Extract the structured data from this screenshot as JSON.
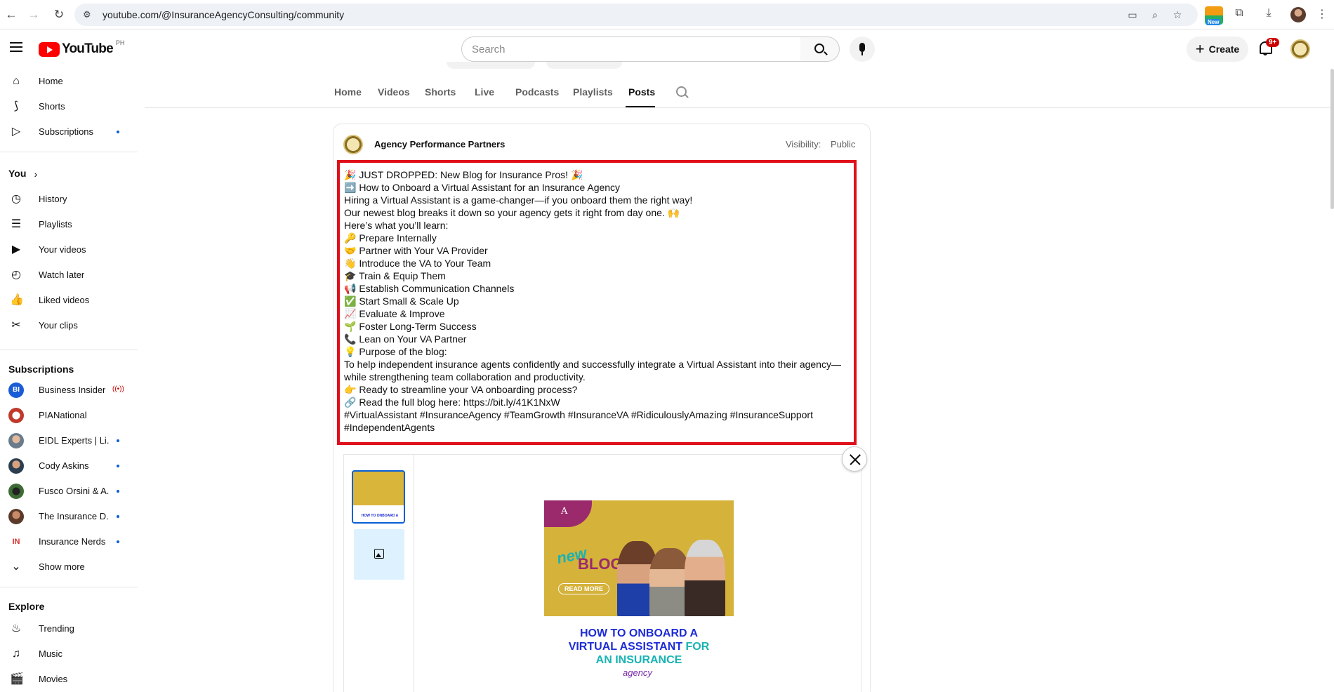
{
  "browser": {
    "url": "youtube.com/@InsuranceAgencyConsulting/community",
    "ext_badge": "New"
  },
  "header": {
    "logo_text": "YouTube",
    "country_code": "PH",
    "search_placeholder": "Search",
    "create_label": "Create",
    "notification_count": "9+"
  },
  "sidebar": {
    "main_items": [
      {
        "label": "Home",
        "icon": "home-icon"
      },
      {
        "label": "Shorts",
        "icon": "shorts-icon"
      },
      {
        "label": "Subscriptions",
        "icon": "subscriptions-icon"
      }
    ],
    "you_title": "You",
    "you_items": [
      {
        "label": "History",
        "icon": "history-icon"
      },
      {
        "label": "Playlists",
        "icon": "playlists-icon"
      },
      {
        "label": "Your videos",
        "icon": "your-videos-icon"
      },
      {
        "label": "Watch later",
        "icon": "watch-later-icon"
      },
      {
        "label": "Liked videos",
        "icon": "liked-videos-icon"
      },
      {
        "label": "Your clips",
        "icon": "clips-icon"
      }
    ],
    "subscriptions_title": "Subscriptions",
    "subscriptions": [
      {
        "label": "Business Insider",
        "color": "#1a5bd6",
        "status": "live"
      },
      {
        "label": "PIANational",
        "color": "#c0392b",
        "status": "none"
      },
      {
        "label": "EIDL Experts | Li...",
        "color": "#6a7b8c",
        "status": "new"
      },
      {
        "label": "Cody Askins",
        "color": "#2c3e50",
        "status": "new"
      },
      {
        "label": "Fusco Orsini & A...",
        "color": "#3d6b35",
        "status": "new"
      },
      {
        "label": "The Insurance D...",
        "color": "#5b3a29",
        "status": "new"
      },
      {
        "label": "Insurance Nerds",
        "color": "#d63031",
        "status": "new"
      }
    ],
    "show_more": "Show more",
    "explore_title": "Explore",
    "explore_items": [
      {
        "label": "Trending",
        "icon": "trending-icon"
      },
      {
        "label": "Music",
        "icon": "music-icon"
      },
      {
        "label": "Movies",
        "icon": "movies-icon"
      }
    ]
  },
  "tabs": {
    "items": [
      "Home",
      "Videos",
      "Shorts",
      "Live",
      "Podcasts",
      "Playlists",
      "Posts"
    ],
    "active": "Posts"
  },
  "post": {
    "author": "Agency Performance Partners",
    "visibility_label": "Visibility:",
    "visibility_value": "Public",
    "lines": [
      "🎉 JUST DROPPED: New Blog for Insurance Pros! 🎉",
      "➡️ How to Onboard a Virtual Assistant for an Insurance Agency",
      "Hiring a Virtual Assistant is a game-changer—if you onboard them the right way!",
      "Our newest blog breaks it down so your agency gets it right from day one. 🙌",
      "Here’s what you’ll learn:",
      "🔑 Prepare Internally",
      "🤝 Partner with Your VA Provider",
      "👋 Introduce the VA to Your Team",
      "🎓 Train & Equip Them",
      "📢 Establish Communication Channels",
      "✅ Start Small & Scale Up",
      "📈 Evaluate & Improve",
      "🌱 Foster Long-Term Success",
      "📞 Lean on Your VA Partner",
      "💡 Purpose of the blog:",
      "To help independent insurance agents confidently and successfully integrate a Virtual Assistant into their agency—",
      "while strengthening team collaboration and productivity.",
      "👉 Ready to streamline your VA onboarding process?",
      "🔗 Read the full blog here: https://bit.ly/41K1NxW",
      "#VirtualAssistant #InsuranceAgency #TeamGrowth #InsuranceVA #RidiculouslyAmazing #InsuranceSupport",
      "#IndependentAgents"
    ],
    "image": {
      "new_word": "new",
      "blog_word": "BLOG",
      "read_more": "READ MORE",
      "headline_1": "HOW TO ONBOARD A",
      "headline_2a": "VIRTUAL ASSISTANT ",
      "headline_2b": "FOR",
      "headline_3": "AN INSURANCE",
      "headline_4": "agency"
    }
  }
}
